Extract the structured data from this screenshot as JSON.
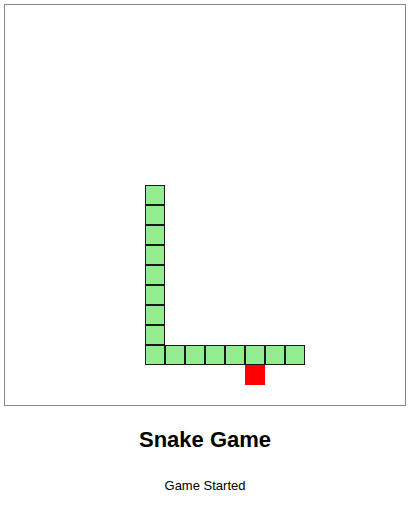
{
  "board": {
    "cols": 20,
    "rows": 20
  },
  "snake": [
    {
      "x": 14,
      "y": 17
    },
    {
      "x": 13,
      "y": 17
    },
    {
      "x": 12,
      "y": 17
    },
    {
      "x": 11,
      "y": 17
    },
    {
      "x": 10,
      "y": 17
    },
    {
      "x": 9,
      "y": 17
    },
    {
      "x": 8,
      "y": 17
    },
    {
      "x": 7,
      "y": 17
    },
    {
      "x": 7,
      "y": 16
    },
    {
      "x": 7,
      "y": 15
    },
    {
      "x": 7,
      "y": 14
    },
    {
      "x": 7,
      "y": 13
    },
    {
      "x": 7,
      "y": 12
    },
    {
      "x": 7,
      "y": 11
    },
    {
      "x": 7,
      "y": 10
    },
    {
      "x": 7,
      "y": 9
    }
  ],
  "food": {
    "x": 12,
    "y": 18
  },
  "title": "Snake Game",
  "status": "Game Started"
}
